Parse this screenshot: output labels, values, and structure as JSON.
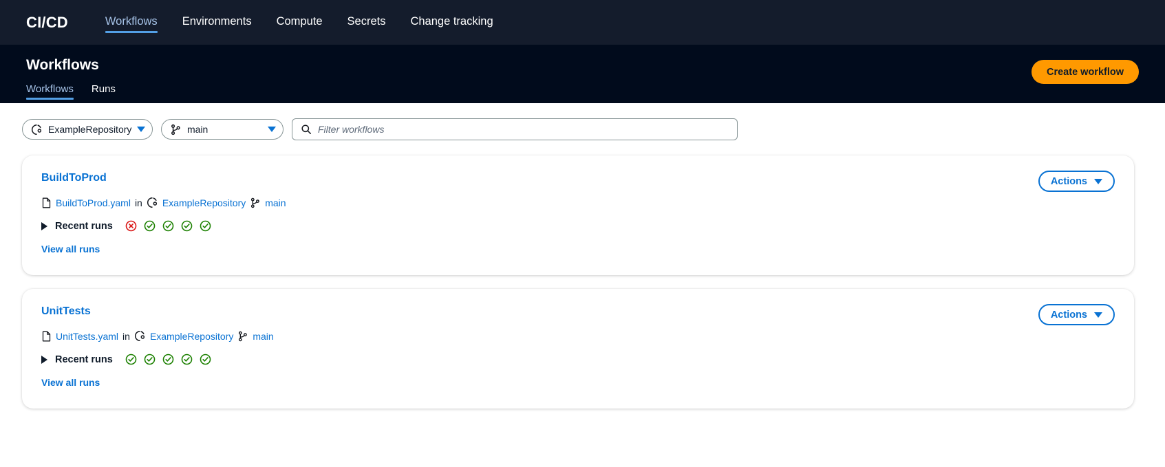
{
  "topnav": {
    "brand": "CI/CD",
    "items": [
      {
        "label": "Workflows",
        "active": true
      },
      {
        "label": "Environments",
        "active": false
      },
      {
        "label": "Compute",
        "active": false
      },
      {
        "label": "Secrets",
        "active": false
      },
      {
        "label": "Change tracking",
        "active": false
      }
    ]
  },
  "pagehead": {
    "title": "Workflows",
    "tabs": [
      {
        "label": "Workflows",
        "active": true
      },
      {
        "label": "Runs",
        "active": false
      }
    ],
    "create_button": "Create workflow"
  },
  "filterbar": {
    "repository_select": {
      "value": "ExampleRepository",
      "icon": "repository-icon",
      "caret": "chevron-down-icon"
    },
    "branch_select": {
      "value": "main",
      "icon": "branch-icon",
      "caret": "chevron-down-icon"
    },
    "search": {
      "placeholder": "Filter workflows",
      "value": "",
      "icon": "search-icon"
    }
  },
  "workflows": [
    {
      "name": "BuildToProd",
      "file": "BuildToProd.yaml",
      "in_label": "in",
      "repository": "ExampleRepository",
      "branch": "main",
      "recent_runs_label": "Recent runs",
      "recent_runs_expanded": false,
      "run_statuses": [
        "failed",
        "succeeded",
        "succeeded",
        "succeeded",
        "succeeded"
      ],
      "view_all_label": "View all runs",
      "actions_label": "Actions"
    },
    {
      "name": "UnitTests",
      "file": "UnitTests.yaml",
      "in_label": "in",
      "repository": "ExampleRepository",
      "branch": "main",
      "recent_runs_label": "Recent runs",
      "recent_runs_expanded": false,
      "run_statuses": [
        "succeeded",
        "succeeded",
        "succeeded",
        "succeeded",
        "succeeded"
      ],
      "view_all_label": "View all runs",
      "actions_label": "Actions"
    }
  ],
  "colors": {
    "topnav_bg": "#141c2c",
    "pagehead_bg": "#010b1c",
    "accent_orange": "#ff9900",
    "link_blue": "#0972d3",
    "tab_underline": "#539fe5",
    "status_success": "#1d8102",
    "status_failed": "#d91515"
  }
}
